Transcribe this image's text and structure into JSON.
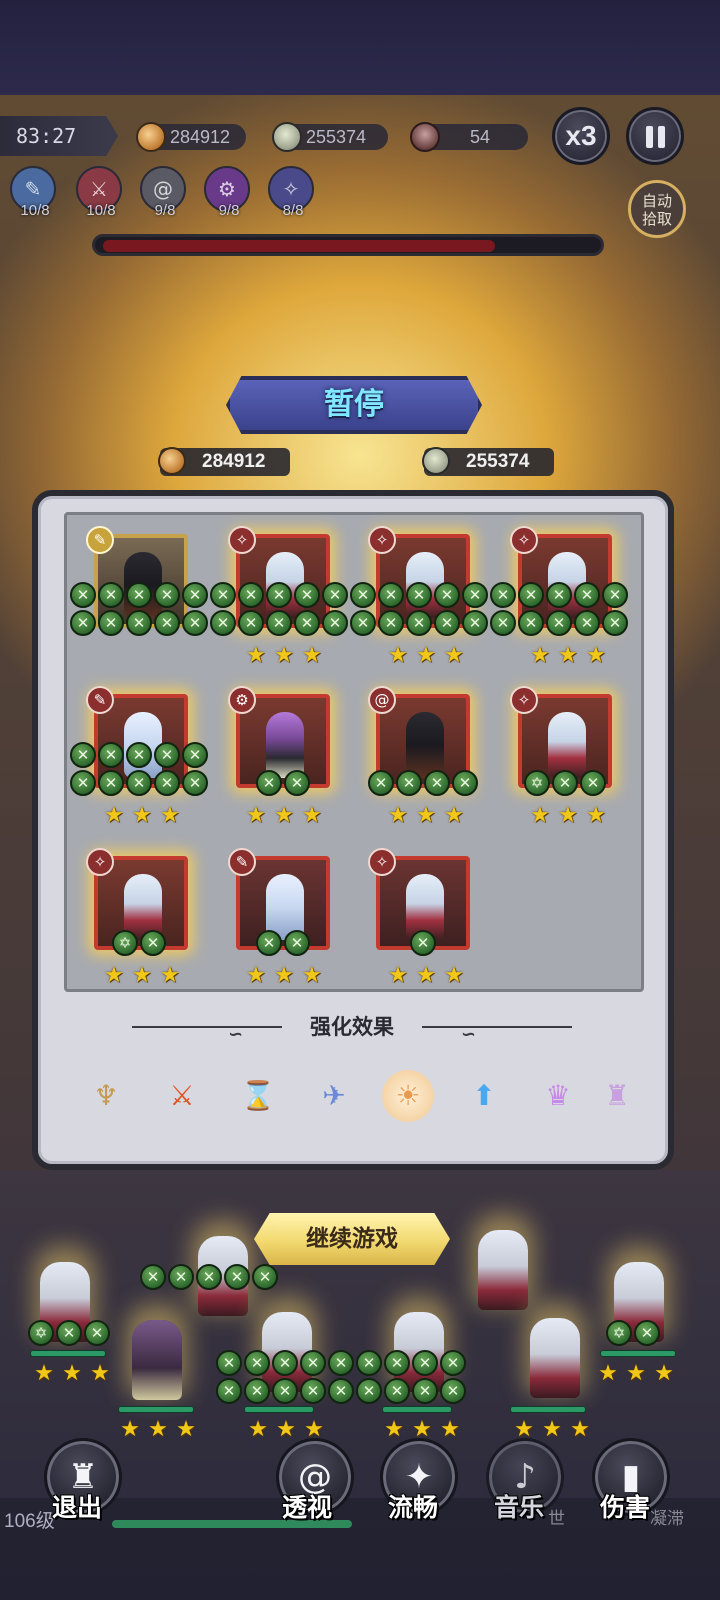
{
  "hud": {
    "timer": "83:27",
    "gold": "284912",
    "kills": "255374",
    "wave": "54",
    "speed_label": "x3",
    "auto_pickup": "自动\n拾取",
    "boss_hp_fraction": 0.8
  },
  "hero_classes": [
    {
      "name": "wand-class-icon",
      "count": "10/8",
      "color": "#4a6aa0"
    },
    {
      "name": "sword-class-icon",
      "count": "10/8",
      "color": "#8a3a44"
    },
    {
      "name": "swirl-class-icon",
      "count": "9/8",
      "color": "#5a5a64"
    },
    {
      "name": "gear-class-icon",
      "count": "9/8",
      "color": "#6a3a8a"
    },
    {
      "name": "wrench-class-icon",
      "count": "8/8",
      "color": "#4a4a8a"
    }
  ],
  "pause": {
    "title": "暂停",
    "gold": "284912",
    "kills": "255374",
    "section_title": "强化效果",
    "continue_label": "继续游戏"
  },
  "bottom": {
    "level": "106级",
    "buttons": [
      {
        "label": "退出",
        "icon": "castle-icon"
      },
      {
        "label": "透视",
        "icon": "vortex-icon"
      },
      {
        "label": "流畅",
        "icon": "sparkle-icon"
      },
      {
        "label": "音乐",
        "icon": "speaker-icon"
      },
      {
        "label": "伤害",
        "icon": "bar-chart-icon"
      }
    ],
    "ghost_labels": [
      "世",
      "凝滞"
    ]
  },
  "colors": {
    "accent_gold": "#f2d970",
    "banner_blue": "#3b428c",
    "card_red": "#c23b2e",
    "orb_green": "#2e6a2e",
    "star_yellow": "#f2c818"
  }
}
